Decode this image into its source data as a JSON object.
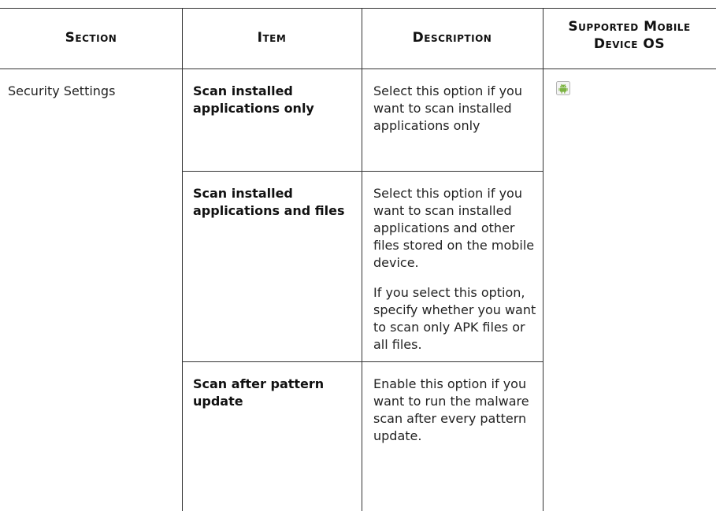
{
  "headers": {
    "section": "Section",
    "item": "Item",
    "description": "Description",
    "os_line1": "Supported Mobile",
    "os_line2": "Device OS"
  },
  "section_cell": "Security Settings",
  "rows": [
    {
      "item": "Scan installed applications only",
      "description": [
        "Select this option if you want to scan installed applications only"
      ]
    },
    {
      "item": "Scan installed applications and files",
      "description": [
        "Select this option if you want to scan installed applications and other files stored on the mobile device.",
        "If you select this option, specify whether you want to scan only APK files or all files."
      ]
    },
    {
      "item": "Scan after pattern update",
      "description": [
        "Enable this option if you want to run the malware scan after every pattern update."
      ]
    }
  ],
  "os_icon": "android-icon",
  "colors": {
    "rule": "#333333",
    "android_green": "#7cb342"
  }
}
